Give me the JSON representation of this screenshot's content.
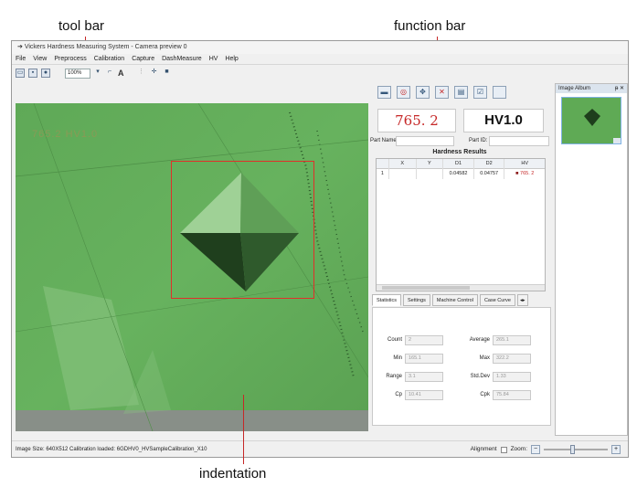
{
  "callouts": {
    "tool_bar": "tool bar",
    "function_bar": "function bar",
    "indentation": "indentation"
  },
  "window": {
    "title": "Vickers Hardness Measuring System - Camera preview 0",
    "menu": [
      "File",
      "View",
      "Preprocess",
      "Calibration",
      "Capture",
      "DashMeasure",
      "HV",
      "Help"
    ]
  },
  "toolbar": {
    "zoom_value": "100%",
    "text_tool": "A"
  },
  "camera": {
    "reading": "765.2 HV1.0"
  },
  "results": {
    "value": "765. 2",
    "scale": "HV1.0",
    "part_name_label": "Part Name:",
    "part_id_label": "Part ID:",
    "title": "Hardness Results",
    "columns": [
      "",
      "X",
      "Y",
      "D1",
      "D2",
      "HV"
    ],
    "rows": [
      {
        "n": "1",
        "x": "",
        "y": "",
        "d1": "0.04582",
        "d2": "0.04757",
        "hv": "765. 2"
      }
    ]
  },
  "tabs": [
    "Statistics",
    "Settings",
    "Machine Control",
    "Case Curve"
  ],
  "statistics": {
    "count_label": "Count",
    "count": "2",
    "average_label": "Average",
    "average": "265.1",
    "min_label": "Min",
    "min": "165.1",
    "max_label": "Max",
    "max": "322.2",
    "range_label": "Range",
    "range": "3.1",
    "stddev_label": "Std.Dev",
    "stddev": "1.33",
    "cp_label": "Cp",
    "cp": "10.41",
    "cpk_label": "Cpk",
    "cpk": "75.84"
  },
  "album": {
    "title": "Image Album",
    "pin": "ᵽ ✕"
  },
  "status": {
    "text": "Image Size: 640X512  Calibration loaded: 6GDHV0_HVSampleCalibration_X10",
    "alignment_label": "Alignment",
    "zoom_label": "Zoom:",
    "zoom_fraction": 0.45
  },
  "colors": {
    "camera_green": "#62ae5a",
    "result_red": "#c62828",
    "indent_box": "#e0302a"
  }
}
